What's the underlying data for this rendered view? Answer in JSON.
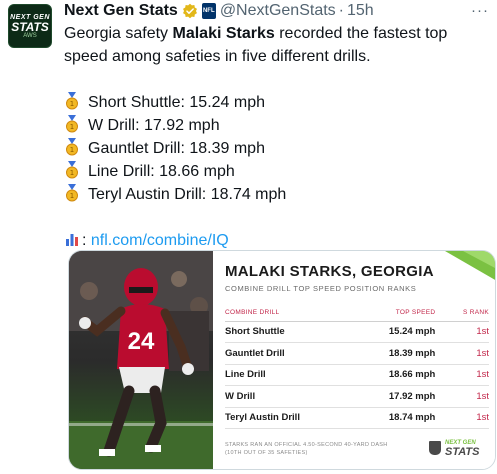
{
  "tweet": {
    "author_name": "Next Gen Stats",
    "handle": "@NextGenStats",
    "separator": "·",
    "time": "15h",
    "more": "···",
    "avatar": {
      "line1": "NEXT GEN",
      "line2": "STATS",
      "line3": "AWS"
    },
    "text_line1": "Georgia safety ",
    "text_bold": "Malaki Starks",
    "text_line1_end": " recorded the fastest top",
    "text_line2": "speed among safeties in five different drills.",
    "drills": [
      "Short Shuttle: 15.24 mph",
      "W Drill: 17.92 mph",
      "Gauntlet Drill: 18.39 mph",
      "Line Drill: 18.66 mph",
      "Teryl Austin Drill: 18.74 mph"
    ],
    "link_prefix": ": ",
    "link": "nfl.com/combine/IQ",
    "icons": [
      "verified-badge-icon",
      "nfl-shield-icon",
      "gold-medal-icon",
      "bar-chart-icon",
      "more-icon"
    ]
  },
  "card": {
    "photo_jersey_number": "24",
    "title": "MALAKI STARKS, GEORGIA",
    "subtitle": "COMBINE DRILL TOP SPEED POSITION RANKS",
    "columns": [
      "COMBINE DRILL",
      "TOP SPEED",
      "S RANK"
    ],
    "rows": [
      [
        "Short Shuttle",
        "15.24 mph",
        "1st"
      ],
      [
        "Gauntlet Drill",
        "18.39 mph",
        "1st"
      ],
      [
        "Line Drill",
        "18.66 mph",
        "1st"
      ],
      [
        "W Drill",
        "17.92 mph",
        "1st"
      ],
      [
        "Teryl Austin Drill",
        "18.74 mph",
        "1st"
      ]
    ],
    "footnote": "STARKS RAN AN OFFICIAL 4.50-SECOND 40-YARD DASH (10TH OUT OF 35 SAFETIES)",
    "logo_line1": "NEXT GEN",
    "logo_line2": "STATS",
    "colors": {
      "accent_green": "#7bc142",
      "rank_red": "#c2274a",
      "uga_red": "#ba0c2f",
      "link_blue": "#1d9bf0"
    }
  }
}
